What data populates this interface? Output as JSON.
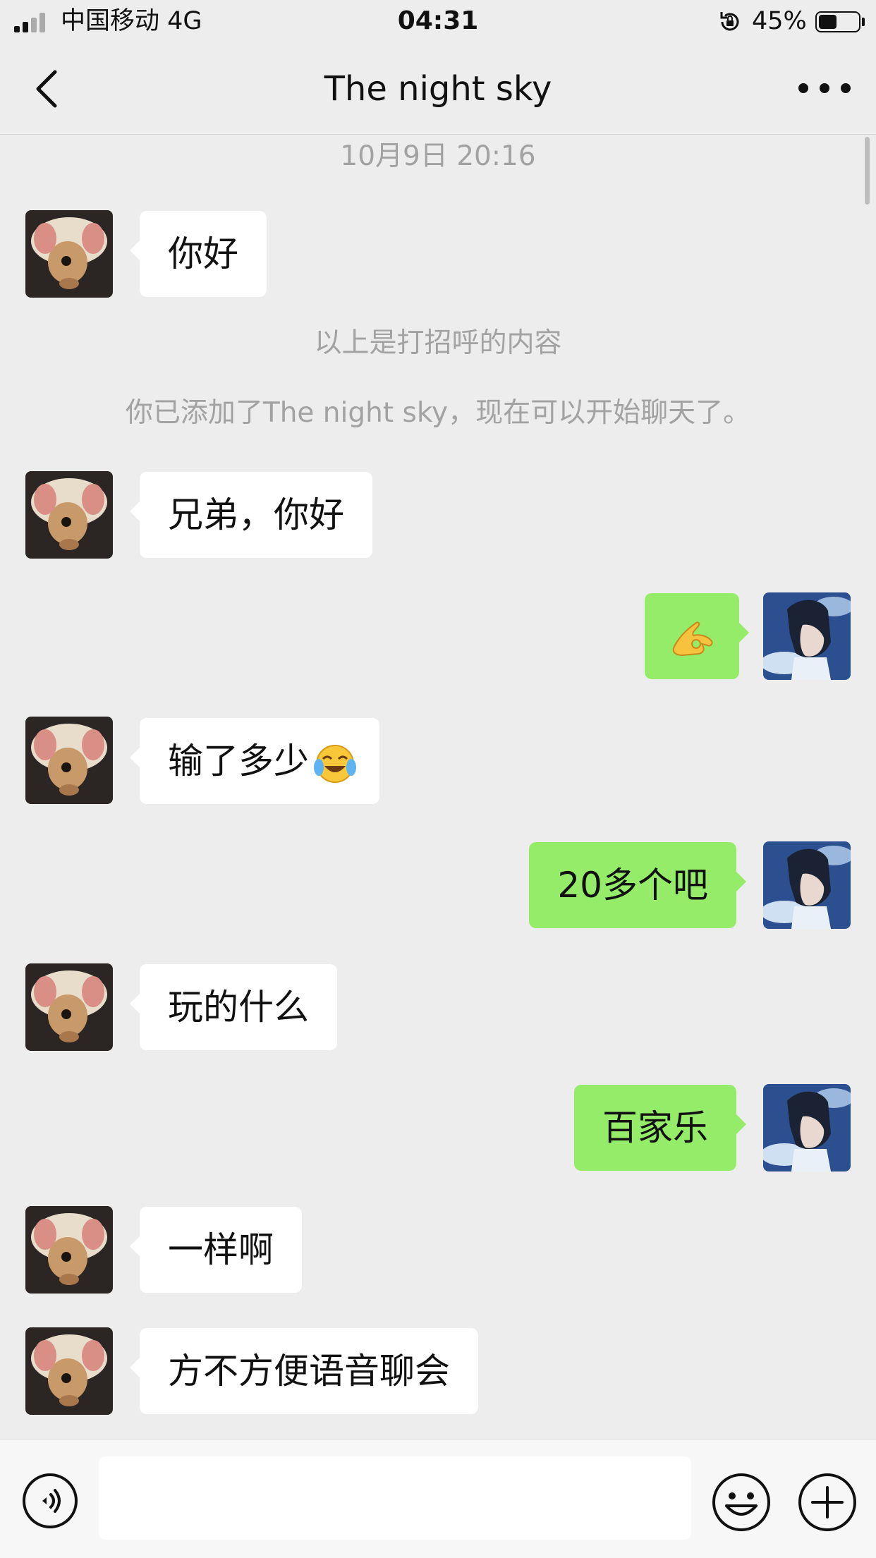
{
  "status_bar": {
    "carrier": "中国移动  4G",
    "time": "04:31",
    "battery_percent": "45%",
    "battery_level": 0.45
  },
  "header": {
    "title": "The night sky",
    "back_icon": "chevron-left-icon",
    "more_icon": "more-dots-icon"
  },
  "chat": {
    "timestamp": "10月9日 20:16",
    "system_messages": [
      "以上是打招呼的内容",
      "你已添加了The night sky，现在可以开始聊天了。"
    ],
    "messages": [
      {
        "from": "contact",
        "text": "你好"
      },
      {
        "from": "contact",
        "text": "兄弟，你好"
      },
      {
        "from": "me",
        "text": "",
        "emoji": "ok-hand-emoji"
      },
      {
        "from": "contact",
        "text": "输了多少",
        "emoji": "face-with-tears-of-joy-emoji"
      },
      {
        "from": "me",
        "text": "20多个吧"
      },
      {
        "from": "contact",
        "text": "玩的什么"
      },
      {
        "from": "me",
        "text": "百家乐"
      },
      {
        "from": "contact",
        "text": "一样啊"
      },
      {
        "from": "contact",
        "text": "方不方便语音聊会"
      }
    ]
  },
  "input_bar": {
    "voice_icon": "voice-icon",
    "input_value": "",
    "emoji_icon": "smiley-icon",
    "plus_icon": "plus-circle-icon"
  },
  "colors": {
    "background": "#ededed",
    "incoming_bubble": "#ffffff",
    "outgoing_bubble": "#95ec69",
    "system_text": "#a2a2a2"
  }
}
